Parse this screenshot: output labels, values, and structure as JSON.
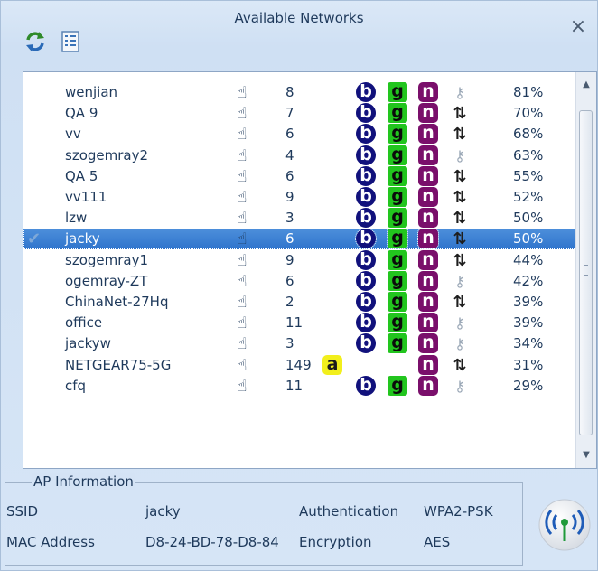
{
  "window": {
    "title": "Available Networks",
    "close_label": "×"
  },
  "toolbar": {
    "refresh_icon": "refresh-icon",
    "list_icon": "list-icon"
  },
  "networks": [
    {
      "ssid": "wenjian",
      "channel": "8",
      "a": "",
      "b": "b",
      "g": "g",
      "n": "n",
      "security": "key",
      "signal": "81%",
      "connected": false
    },
    {
      "ssid": "QA 9",
      "channel": "7",
      "a": "",
      "b": "b",
      "g": "g",
      "n": "n",
      "security": "lock",
      "signal": "70%",
      "connected": false
    },
    {
      "ssid": "vv",
      "channel": "6",
      "a": "",
      "b": "b",
      "g": "g",
      "n": "n",
      "security": "lock",
      "signal": "68%",
      "connected": false
    },
    {
      "ssid": "szogemray2",
      "channel": "4",
      "a": "",
      "b": "b",
      "g": "g",
      "n": "n",
      "security": "key",
      "signal": "63%",
      "connected": false
    },
    {
      "ssid": "QA 5",
      "channel": "6",
      "a": "",
      "b": "b",
      "g": "g",
      "n": "n",
      "security": "lock",
      "signal": "55%",
      "connected": false
    },
    {
      "ssid": "vv111",
      "channel": "9",
      "a": "",
      "b": "b",
      "g": "g",
      "n": "n",
      "security": "lock",
      "signal": "52%",
      "connected": false
    },
    {
      "ssid": "lzw",
      "channel": "3",
      "a": "",
      "b": "b",
      "g": "g",
      "n": "n",
      "security": "lock",
      "signal": "50%",
      "connected": false
    },
    {
      "ssid": "jacky",
      "channel": "6",
      "a": "",
      "b": "b",
      "g": "g",
      "n": "n",
      "security": "lock",
      "signal": "50%",
      "connected": true
    },
    {
      "ssid": "szogemray1",
      "channel": "9",
      "a": "",
      "b": "b",
      "g": "g",
      "n": "n",
      "security": "lock",
      "signal": "44%",
      "connected": false
    },
    {
      "ssid": "ogemray-ZT",
      "channel": "6",
      "a": "",
      "b": "b",
      "g": "g",
      "n": "n",
      "security": "key",
      "signal": "42%",
      "connected": false
    },
    {
      "ssid": "ChinaNet-27Hq",
      "channel": "2",
      "a": "",
      "b": "b",
      "g": "g",
      "n": "n",
      "security": "lock",
      "signal": "39%",
      "connected": false
    },
    {
      "ssid": "office",
      "channel": "11",
      "a": "",
      "b": "b",
      "g": "g",
      "n": "n",
      "security": "key",
      "signal": "39%",
      "connected": false
    },
    {
      "ssid": "jackyw",
      "channel": "3",
      "a": "",
      "b": "b",
      "g": "g",
      "n": "n",
      "security": "key",
      "signal": "34%",
      "connected": false
    },
    {
      "ssid": "NETGEAR75-5G",
      "channel": "149",
      "a": "a",
      "b": "",
      "g": "",
      "n": "n",
      "security": "lock",
      "signal": "31%",
      "connected": false
    },
    {
      "ssid": "cfq",
      "channel": "11",
      "a": "",
      "b": "b",
      "g": "g",
      "n": "n",
      "security": "key",
      "signal": "29%",
      "connected": false
    }
  ],
  "ap_info": {
    "title": "AP Information",
    "ssid_label": "SSID",
    "ssid_value": "jacky",
    "auth_label": "Authentication",
    "auth_value": "WPA2-PSK",
    "mac_label": "MAC Address",
    "mac_value": "D8-24-BD-78-D8-84",
    "enc_label": "Encryption",
    "enc_value": "AES"
  },
  "colors": {
    "selected_row": "#3b7fd4",
    "badge_b": "#11117c",
    "badge_g": "#22c51e",
    "badge_n": "#7a0f6b",
    "badge_a": "#f2ef1c"
  }
}
